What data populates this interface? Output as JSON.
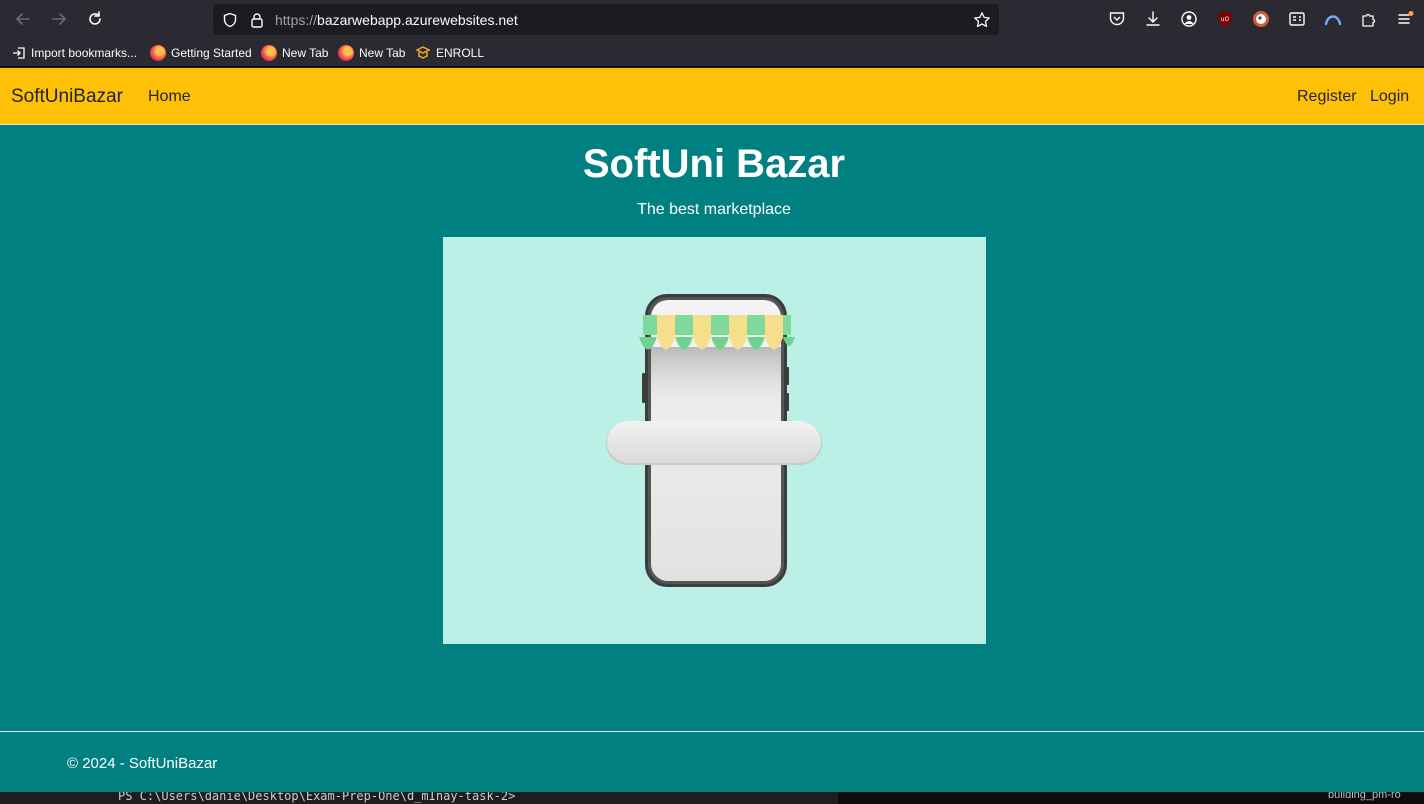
{
  "browser": {
    "url_scheme": "https://",
    "url_host": "bazarwebapp.azurewebsites.net",
    "bookmarks": [
      {
        "label": "Import bookmarks...",
        "icon": "import-icon"
      },
      {
        "label": "Getting Started",
        "icon": "firefox-icon"
      },
      {
        "label": "New Tab",
        "icon": "firefox-icon"
      },
      {
        "label": "New Tab",
        "icon": "firefox-icon"
      },
      {
        "label": "ENROLL",
        "icon": "enroll-icon"
      }
    ]
  },
  "navbar": {
    "brand": "SoftUniBazar",
    "home": "Home",
    "register": "Register",
    "login": "Login"
  },
  "hero": {
    "title": "SoftUni Bazar",
    "subtitle": "The best marketplace",
    "image_description": "phone-shop-illustration"
  },
  "footer": {
    "text": "© 2024 - SoftUniBazar"
  },
  "background": {
    "terminal_text": "PS C:\\Users\\danie\\Desktop\\Exam-Prep-One\\d_mInay-task-2> ",
    "desktop_text": "building_pm-ro"
  },
  "colors": {
    "navbar": "#ffc107",
    "page_background": "#008080",
    "hero_image_background": "#bbf0e6"
  }
}
